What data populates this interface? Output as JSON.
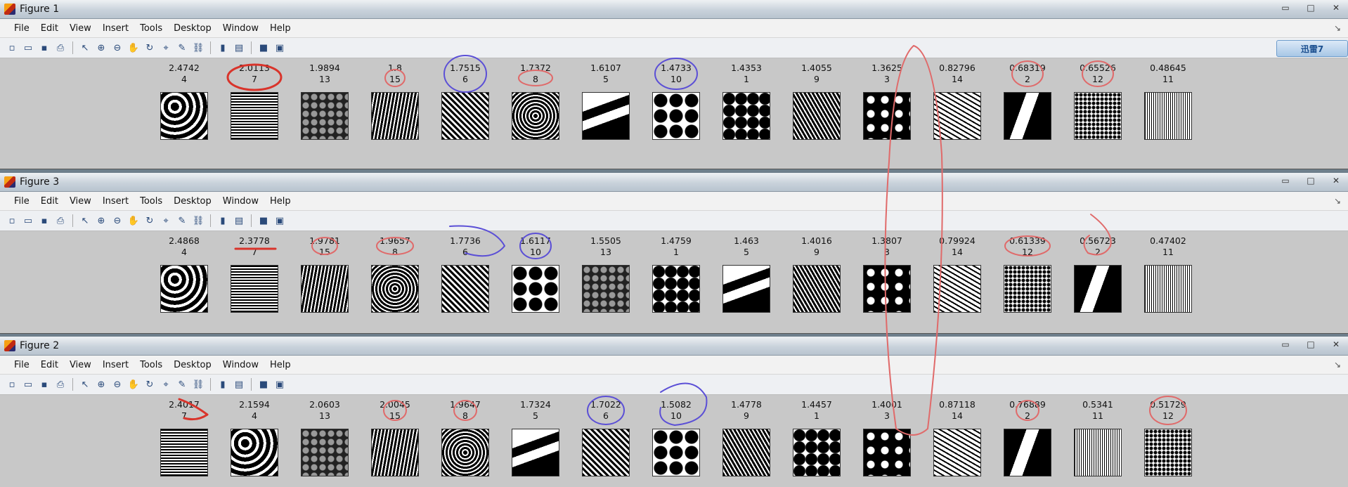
{
  "menu": [
    "File",
    "Edit",
    "View",
    "Insert",
    "Tools",
    "Desktop",
    "Window",
    "Help"
  ],
  "toolbar_icons": [
    "new-file-icon",
    "open-folder-icon",
    "save-icon",
    "print-icon",
    "pointer-icon",
    "zoom-in-icon",
    "zoom-out-icon",
    "pan-icon",
    "rotate-icon",
    "data-cursor-icon",
    "brush-icon",
    "link-icon",
    "colorbar-icon",
    "legend-icon",
    "hide-plot-tools-icon",
    "show-plot-tools-icon"
  ],
  "badge": {
    "label": "迅雷7"
  },
  "window_controls": {
    "minimize": "▭",
    "maximize": "□",
    "close": "✕"
  },
  "figures": [
    {
      "title": "Figure 1",
      "items": [
        {
          "value": "2.4742",
          "index": "4",
          "tex": 0
        },
        {
          "value": "2.0113",
          "index": "7",
          "tex": 1
        },
        {
          "value": "1.9894",
          "index": "13",
          "tex": 2
        },
        {
          "value": "1.8",
          "index": "15",
          "tex": 3
        },
        {
          "value": "1.7515",
          "index": "6",
          "tex": 4
        },
        {
          "value": "1.7372",
          "index": "8",
          "tex": 5
        },
        {
          "value": "1.6107",
          "index": "5",
          "tex": 6
        },
        {
          "value": "1.4733",
          "index": "10",
          "tex": 7
        },
        {
          "value": "1.4353",
          "index": "1",
          "tex": 8
        },
        {
          "value": "1.4055",
          "index": "9",
          "tex": 9
        },
        {
          "value": "1.3625",
          "index": "3",
          "tex": 10
        },
        {
          "value": "0.82796",
          "index": "14",
          "tex": 11
        },
        {
          "value": "0.68319",
          "index": "2",
          "tex": 12
        },
        {
          "value": "0.65526",
          "index": "12",
          "tex": 13
        },
        {
          "value": "0.48645",
          "index": "11",
          "tex": 14
        }
      ]
    },
    {
      "title": "Figure 3",
      "items": [
        {
          "value": "2.4868",
          "index": "4",
          "tex": 0
        },
        {
          "value": "2.3778",
          "index": "7",
          "tex": 1
        },
        {
          "value": "1.9781",
          "index": "15",
          "tex": 3
        },
        {
          "value": "1.9657",
          "index": "8",
          "tex": 5
        },
        {
          "value": "1.7736",
          "index": "6",
          "tex": 4
        },
        {
          "value": "1.6117",
          "index": "10",
          "tex": 7
        },
        {
          "value": "1.5505",
          "index": "13",
          "tex": 2
        },
        {
          "value": "1.4759",
          "index": "1",
          "tex": 8
        },
        {
          "value": "1.463",
          "index": "5",
          "tex": 6
        },
        {
          "value": "1.4016",
          "index": "9",
          "tex": 9
        },
        {
          "value": "1.3807",
          "index": "3",
          "tex": 10
        },
        {
          "value": "0.79924",
          "index": "14",
          "tex": 11
        },
        {
          "value": "0.61339",
          "index": "12",
          "tex": 13
        },
        {
          "value": "0.56723",
          "index": "2",
          "tex": 12
        },
        {
          "value": "0.47402",
          "index": "11",
          "tex": 14
        }
      ]
    },
    {
      "title": "Figure 2",
      "items": [
        {
          "value": "2.4017",
          "index": "7",
          "tex": 1
        },
        {
          "value": "2.1594",
          "index": "4",
          "tex": 0
        },
        {
          "value": "2.0603",
          "index": "13",
          "tex": 2
        },
        {
          "value": "2.0045",
          "index": "15",
          "tex": 3
        },
        {
          "value": "1.9647",
          "index": "8",
          "tex": 5
        },
        {
          "value": "1.7324",
          "index": "5",
          "tex": 6
        },
        {
          "value": "1.7022",
          "index": "6",
          "tex": 4
        },
        {
          "value": "1.5082",
          "index": "10",
          "tex": 7
        },
        {
          "value": "1.4778",
          "index": "9",
          "tex": 9
        },
        {
          "value": "1.4457",
          "index": "1",
          "tex": 8
        },
        {
          "value": "1.4001",
          "index": "3",
          "tex": 10
        },
        {
          "value": "0.87118",
          "index": "14",
          "tex": 11
        },
        {
          "value": "0.76889",
          "index": "2",
          "tex": 12
        },
        {
          "value": "0.5341",
          "index": "11",
          "tex": 14
        },
        {
          "value": "0.51729",
          "index": "12",
          "tex": 13
        }
      ]
    }
  ],
  "annotation_colors": {
    "red": "#d9342b",
    "blue": "#5b4fd6",
    "pink": "#e06a6a"
  }
}
